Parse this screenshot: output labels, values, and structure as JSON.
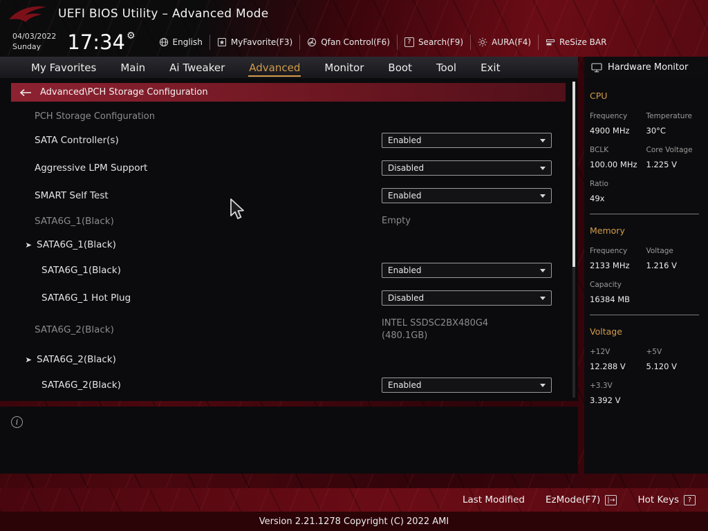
{
  "window": {
    "title": "UEFI BIOS Utility – Advanced Mode",
    "date": "04/03/2022",
    "day": "Sunday",
    "time": "17:34"
  },
  "toolbar": {
    "items": [
      {
        "label": "English",
        "icon": "globe-icon"
      },
      {
        "label": "MyFavorite(F3)",
        "icon": "myfavorite-icon"
      },
      {
        "label": "Qfan Control(F6)",
        "icon": "qfan-icon"
      },
      {
        "label": "Search(F9)",
        "icon": "search-icon"
      },
      {
        "label": "AURA(F4)",
        "icon": "aura-icon"
      },
      {
        "label": "ReSize BAR",
        "icon": "resize-bar-icon"
      }
    ]
  },
  "nav": {
    "active": "Advanced",
    "items": [
      {
        "label": "My Favorites"
      },
      {
        "label": "Main"
      },
      {
        "label": "Ai Tweaker"
      },
      {
        "label": "Advanced"
      },
      {
        "label": "Monitor"
      },
      {
        "label": "Boot"
      },
      {
        "label": "Tool"
      },
      {
        "label": "Exit"
      }
    ]
  },
  "breadcrumb": {
    "label": "Advanced\\PCH Storage Configuration"
  },
  "content": {
    "section_title": "PCH Storage Configuration",
    "rows": [
      {
        "type": "select",
        "label": "SATA Controller(s)",
        "value": "Enabled"
      },
      {
        "type": "select",
        "label": "Aggressive LPM Support",
        "value": "Disabled"
      },
      {
        "type": "select",
        "label": "SMART Self Test",
        "value": "Enabled"
      },
      {
        "type": "static",
        "label": "SATA6G_1(Black)",
        "value": "Empty"
      },
      {
        "type": "expand",
        "label": "SATA6G_1(Black)"
      },
      {
        "type": "select",
        "label": "SATA6G_1(Black)",
        "value": "Enabled"
      },
      {
        "type": "select",
        "label": "SATA6G_1 Hot Plug",
        "value": "Disabled"
      },
      {
        "type": "static",
        "label": "SATA6G_2(Black)",
        "value": "INTEL SSDSC2BX480G4",
        "value2": "(480.1GB)"
      },
      {
        "type": "expand",
        "label": "SATA6G_2(Black)"
      },
      {
        "type": "select",
        "label": "SATA6G_2(Black)",
        "value": "Enabled"
      }
    ]
  },
  "hardware_monitor": {
    "title": "Hardware Monitor",
    "cpu": {
      "title": "CPU",
      "freq_label": "Frequency",
      "freq_value": "4900 MHz",
      "temp_label": "Temperature",
      "temp_value": "30°C",
      "bclk_label": "BCLK",
      "bclk_value": "100.00 MHz",
      "corev_label": "Core Voltage",
      "corev_value": "1.225 V",
      "ratio_label": "Ratio",
      "ratio_value": "49x"
    },
    "memory": {
      "title": "Memory",
      "freq_label": "Frequency",
      "freq_value": "2133 MHz",
      "volt_label": "Voltage",
      "volt_value": "1.216 V",
      "cap_label": "Capacity",
      "cap_value": "16384 MB"
    },
    "voltage": {
      "title": "Voltage",
      "v12_label": "+12V",
      "v12_value": "12.288 V",
      "v5_label": "+5V",
      "v5_value": "5.120 V",
      "v33_label": "+3.3V",
      "v33_value": "3.392 V"
    }
  },
  "footer": {
    "last_modified": "Last Modified",
    "ezmode": "EzMode(F7)",
    "ezmode_icon": "|→",
    "hot_keys": "Hot Keys",
    "hot_keys_icon": "?",
    "version": "Version 2.21.1278 Copyright (C) 2022 AMI"
  },
  "colors": {
    "accent_orange": "#d39c4a",
    "breadcrumb_red": "#8d2231",
    "background_red": "#3e060c",
    "panel_black": "#0b0b0d"
  }
}
